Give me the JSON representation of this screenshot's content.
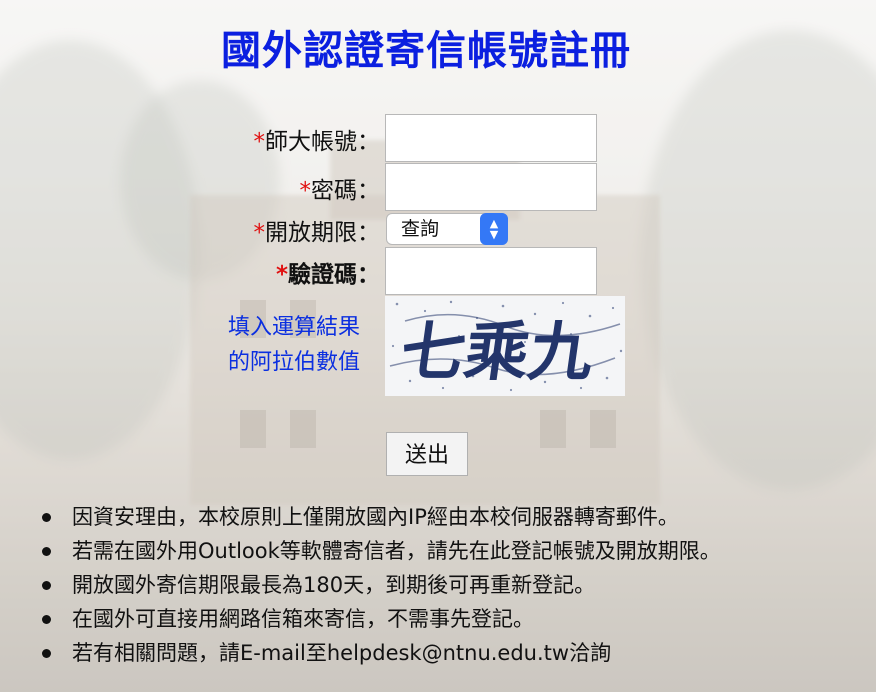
{
  "page": {
    "title": "國外認證寄信帳號註冊"
  },
  "form": {
    "account": {
      "required_mark": "*",
      "label": "師大帳號：",
      "value": ""
    },
    "password": {
      "required_mark": "*",
      "label": "密碼：",
      "value": ""
    },
    "period": {
      "required_mark": "*",
      "label": "開放期限：",
      "selected": "查詢"
    },
    "captcha": {
      "required_mark": "*",
      "label": "驗證碼：",
      "value": ""
    },
    "captcha_hint_line1": "填入運算結果",
    "captcha_hint_line2": "的阿拉伯數值",
    "captcha_image_text": "七乘九",
    "submit_label": "送出"
  },
  "notes": [
    "因資安理由，本校原則上僅開放國內IP經由本校伺服器轉寄郵件。",
    "若需在國外用Outlook等軟體寄信者，請先在此登記帳號及開放期限。",
    "開放國外寄信期限最長為180天，到期後可再重新登記。",
    "在國外可直接用網路信箱來寄信，不需事先登記。",
    "若有相關問題，請E-mail至helpdesk@ntnu.edu.tw洽詢"
  ],
  "colors": {
    "title": "#0b1fe0",
    "required": "#e01010",
    "hint": "#0b2fe0",
    "select_arrow": "#3478f6"
  }
}
